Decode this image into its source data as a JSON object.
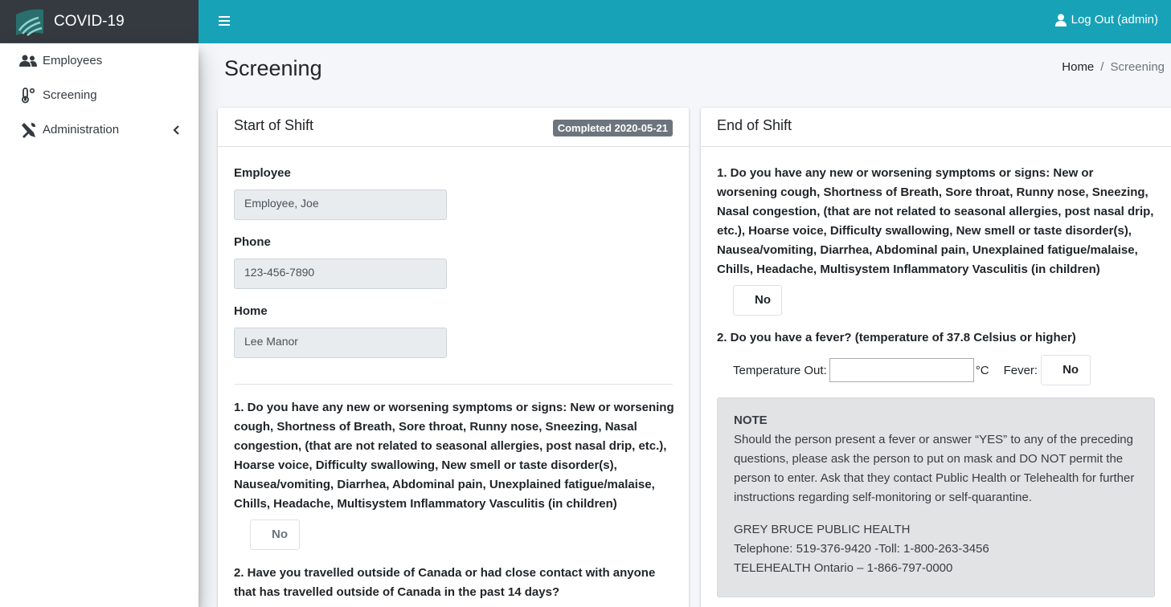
{
  "app": {
    "title": "COVID-19"
  },
  "topbar": {
    "logout_label": "Log Out (admin)"
  },
  "sidebar": {
    "items": [
      {
        "label": "Employees",
        "icon": "users-icon"
      },
      {
        "label": "Screening",
        "icon": "thermometer-icon"
      },
      {
        "label": "Administration",
        "icon": "tools-icon"
      }
    ]
  },
  "page": {
    "title": "Screening"
  },
  "breadcrumb": {
    "home": "Home",
    "separator": "/",
    "current": "Screening"
  },
  "start_shift": {
    "title": "Start of Shift",
    "badge": "Completed 2020-05-21",
    "employee_label": "Employee",
    "employee_value": "Employee, Joe",
    "phone_label": "Phone",
    "phone_value": "123-456-7890",
    "home_label": "Home",
    "home_value": "Lee Manor",
    "q1": "1. Do you have any new or worsening symptoms or signs: New or worsening cough, Shortness of Breath, Sore throat, Runny nose, Sneezing, Nasal congestion, (that are not related to seasonal allergies, post nasal drip, etc.), Hoarse voice, Difficulty swallowing, New smell or taste disorder(s), Nausea/vomiting, Diarrhea, Abdominal pain, Unexplained fatigue/malaise, Chills, Headache, Multisystem Inflammatory Vasculitis (in children)",
    "q1_answer": "No",
    "q2": "2. Have you travelled outside of Canada or had close contact with anyone that has travelled outside of Canada in the past 14 days?"
  },
  "end_shift": {
    "title": "End of Shift",
    "q1": "1. Do you have any new or worsening symptoms or signs: New or worsening cough, Shortness of Breath, Sore throat, Runny nose, Sneezing, Nasal congestion, (that are not related to seasonal allergies, post nasal drip, etc.), Hoarse voice, Difficulty swallowing, New smell or taste disorder(s), Nausea/vomiting, Diarrhea, Abdominal pain, Unexplained fatigue/malaise, Chills, Headache, Multisystem Inflammatory Vasculitis (in children)",
    "q1_answer": "No",
    "q2": "2. Do you have a fever? (temperature of 37.8 Celsius or higher)",
    "temp_label": "Temperature Out:",
    "temp_value": "",
    "temp_unit": "°C",
    "fever_label": "Fever:",
    "fever_answer": "No"
  },
  "note": {
    "title": "NOTE",
    "body": "Should the person present a fever or answer “YES” to any of the preceding questions, please ask the person to put on mask and DO NOT permit the person to enter. Ask that they contact Public Health or Telehealth for further instructions regarding self-monitoring or self-quarantine.",
    "contact_line1": "GREY BRUCE PUBLIC HEALTH",
    "contact_line2": "Telephone: 519-376-9420 -Toll: 1-800-263-3456",
    "contact_line3": "TELEHEALTH Ontario – 1-866-797-0000"
  },
  "colors": {
    "topbar": "#17a2b8",
    "brand_bg": "#343a40",
    "badge": "#6c757d"
  }
}
